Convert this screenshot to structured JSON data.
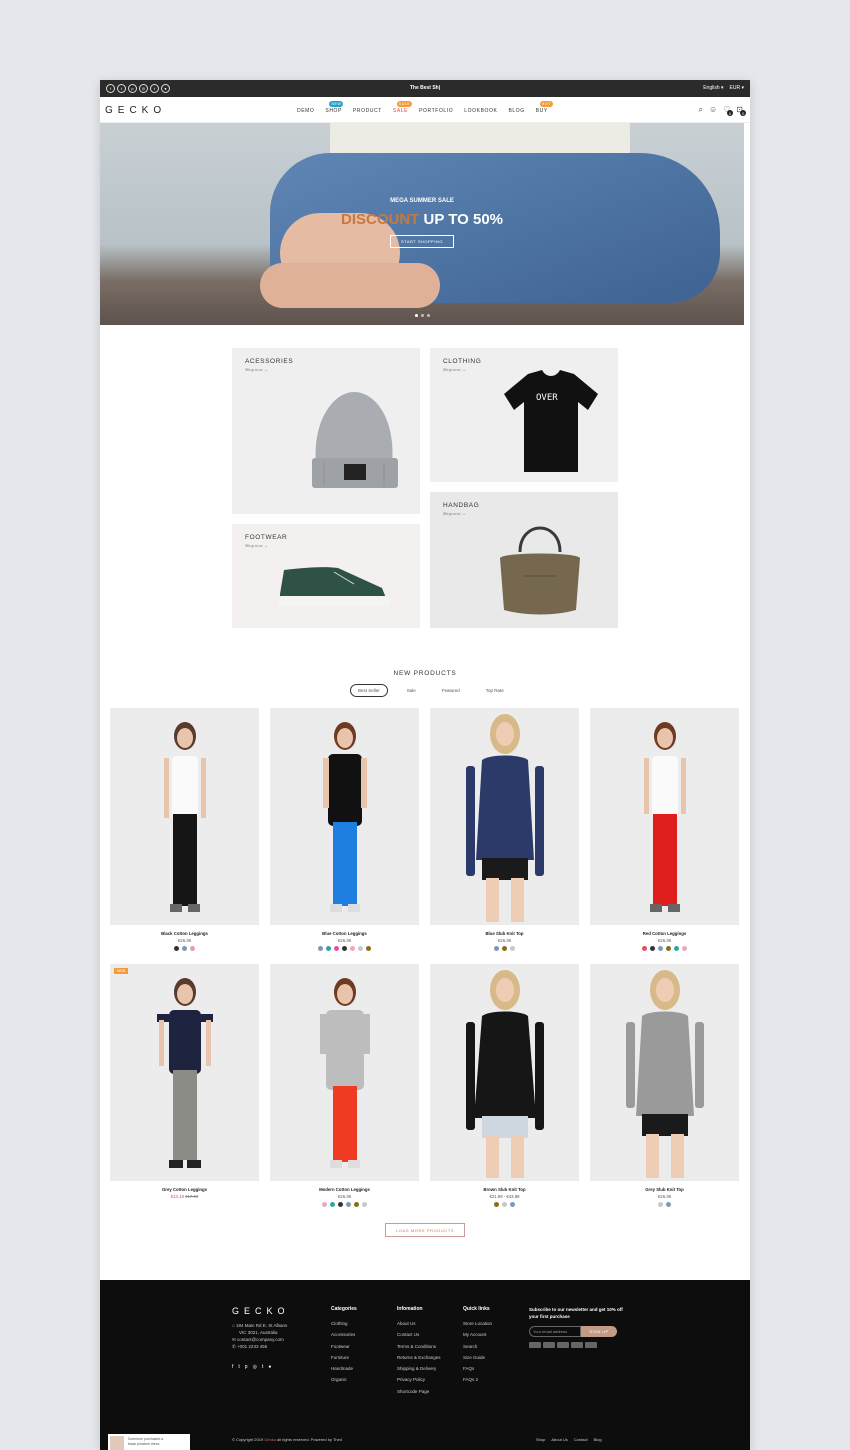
{
  "topbar": {
    "promo": "The Best Sh|",
    "language": "English",
    "currency": "EUR",
    "social_icons": [
      "facebook-icon",
      "twitter-icon",
      "pinterest-icon",
      "instagram-icon",
      "tumblr-icon",
      "other-icon"
    ]
  },
  "header": {
    "logo": "GECKO",
    "nav": [
      {
        "label": "DEMO"
      },
      {
        "label": "SHOP",
        "badge": "NEW",
        "badge_color": "#25a4c6"
      },
      {
        "label": "PRODUCT"
      },
      {
        "label": "SALE",
        "badge": "SALE",
        "badge_color": "#f49a3a"
      },
      {
        "label": "PORTFOLIO"
      },
      {
        "label": "LOOKBOOK"
      },
      {
        "label": "BLOG"
      },
      {
        "label": "BUY",
        "badge": "HOT",
        "badge_color": "#f49a3a"
      }
    ],
    "wishlist_count": "0",
    "cart_count": "0"
  },
  "hero": {
    "subtitle": "MEGA SUMMER SALE",
    "headline_muted": "DISCOUNT",
    "headline": "UP TO 50%",
    "cta": "START SHOPPING",
    "slide_count": 3,
    "active_slide": 1
  },
  "categories": [
    {
      "name": "ACESSORIES",
      "link": "Shop now →"
    },
    {
      "name": "CLOTHING",
      "link": "Shop now →"
    },
    {
      "name": "FOOTWEAR",
      "link": "Shop now →"
    },
    {
      "name": "HANDBAG",
      "link": "Shop now →"
    }
  ],
  "products_section": {
    "title": "NEW PRODUCTS",
    "tabs": [
      "Best Seller",
      "Sale",
      "Featured",
      "Top Rate"
    ],
    "active_tab": "Best Seller",
    "load_more": "LOAD MORE PRODUCTS"
  },
  "products": [
    {
      "name": "Black Cotton Leggings",
      "price": "€26.39",
      "swatches": [
        "#333333",
        "#7c97b8",
        "#e3a1a8"
      ]
    },
    {
      "name": "Blue Cotton Leggings",
      "price": "€26.39",
      "swatches": [
        "#7c97b8",
        "#2ca7a0",
        "#e94ea0",
        "#333333",
        "#f0a6bd",
        "#c8c8c8",
        "#8d6b1d"
      ]
    },
    {
      "name": "Blue Slub Knit Top",
      "price": "€26.39",
      "swatches": [
        "#7c97b8",
        "#8d6b1d",
        "#c8c8c8"
      ]
    },
    {
      "name": "Red Cotton Leggings",
      "price": "€26.39",
      "swatches": [
        "#e94e5a",
        "#333333",
        "#7c97b8",
        "#8d6b1d",
        "#2ca7a0",
        "#f0a6bd"
      ]
    },
    {
      "name": "Grey Cotton Leggings",
      "price_new": "€13.19",
      "price_old": "€17.59",
      "tag": "NEW",
      "swatches": []
    },
    {
      "name": "Modern Cotton Leggings",
      "price": "€26.39",
      "swatches": [
        "#f0a6bd",
        "#2ca7a0",
        "#333333",
        "#7c97b8",
        "#8d6b1d",
        "#c8c8c8"
      ]
    },
    {
      "name": "Brown Slub Knit Top",
      "price": "€21.99 - €43.98",
      "swatches": [
        "#8d6b1d",
        "#c8c8c8",
        "#7c97b8"
      ]
    },
    {
      "name": "Grey Slub Knit Top",
      "price": "€26.39",
      "swatches": [
        "#c8c8c8",
        "#7c97b8"
      ]
    }
  ],
  "footer": {
    "logo": "GECKO",
    "address_line1": "184 Main Rd E, St Albans",
    "address_line2": "VIC 3021, Australia",
    "email": "contact@company.com",
    "phone": "+001 2233 456",
    "columns": [
      {
        "title": "Categories",
        "links": [
          "Clothing",
          "Accessories",
          "Footwear",
          "Furniture",
          "Handmade",
          "Organic"
        ]
      },
      {
        "title": "Infomation",
        "links": [
          "About Us",
          "Contact Us",
          "Terms & Conditions",
          "Returns & Exchanges",
          "Shipping & Delivery",
          "Privacy Policy",
          "Shortcode Page"
        ]
      },
      {
        "title": "Quick links",
        "links": [
          "Store Location",
          "My Account",
          "Search",
          "Size Guide",
          "FAQs",
          "FAQs 2"
        ]
      }
    ],
    "newsletter_title": "Subscribe to our newsletter and get 10% off your first purchase",
    "email_placeholder": "Your email address",
    "signup": "SIGN UP",
    "copyright_pre": "© Copyright 2019",
    "copyright_brand": "Gecko",
    "copyright_post": "all rights reserved. Powered by The4",
    "bottom_links": [
      "Shop",
      "About Us",
      "Contact",
      "Blog"
    ],
    "popup_line1": "Someone purchased a",
    "popup_line2": "black pinafore dress"
  }
}
